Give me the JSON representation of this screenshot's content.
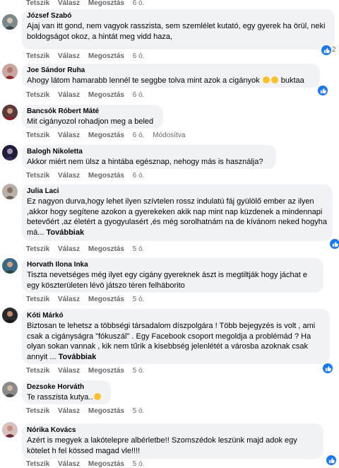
{
  "labels": {
    "like": "Tetszik",
    "reply": "Válasz",
    "share": "Megosztás",
    "more": "Továbbiak",
    "edited": "Módosítva"
  },
  "top_bar": {
    "time": "6 ó."
  },
  "comments": [
    {
      "name": "József Szabó",
      "text": "Ajaj van itt gond, nem vagyok rasszista, sem szemlélet kutató, egy gyerek ha örül, neki boldogságot okoz, a hintát meg vidd haza,",
      "time": "6 ó.",
      "reactions": "2"
    },
    {
      "name": "Joe Sándor Ruha",
      "text": "Ahogy látom hamarabb lennél te seggbe tolva mint azok a cigányok",
      "text_end": "buktaa",
      "time": "6 ó."
    },
    {
      "name": "Bancsók Róbert Máté",
      "text": "Mit cigányozol rohadjon meg a beled",
      "time": "6 ó."
    },
    {
      "name": "Balogh Nikoletta",
      "text": "Akkor miért nem ülsz a hintába egésznap, nehogy más is használja?",
      "time": "6 ó."
    },
    {
      "name": "Julia Laci",
      "text": "Ez nagyon durva,hogy lehet ilyen szívtelen rossz indulatú fáj gyülölő ember az ilyen ,akkor hogy segítene azokon a gyerekeken akik nap mint nap küzdenek a mindennapi betevőért ,az életért a gyogyulasért ,és még sorolhatnám na de kívánom neked hogyha má...",
      "time": "5 ó."
    },
    {
      "name": "Horvath Ilona Inka",
      "text": "Tiszta nevetséges még ilyet egy cigány gyereknek ászt is megtiltják hogy jáchat e egy köszterületen lévö játszo tėren felhäborito",
      "time": "5 ó."
    },
    {
      "name": "Kóti Márkó",
      "text": "Biztosan te lehetsz a többségi társadalom díszpolgára ! Több bejegyzés is volt , ami csak a cigányságra \"fókuszál\" . Egy Facebook csoport megoldja a problémád ? Ha olyan sokan vannak , kik nem tűrik a kisebbség jelenlétét a városba azoknak csak annyit ...",
      "time": "5 ó."
    },
    {
      "name": "Dezsoke Horváth",
      "text": "Te rasszista kutya..",
      "time": "5 ó."
    },
    {
      "name": "Nórika Kovács",
      "text": "Azért is megyek a lakótelepre albérletbe!! Szomszédok leszünk majd adok egy kötelet h fel kössed magad vle!!!!",
      "time": "5 ó."
    }
  ]
}
